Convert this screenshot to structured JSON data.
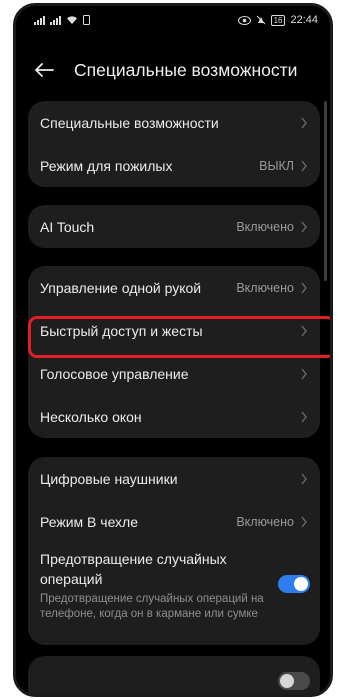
{
  "status": {
    "time": "22:44",
    "battery": "16"
  },
  "header": {
    "title": "Специальные возможности"
  },
  "group1": [
    {
      "label": "Специальные возможности",
      "value": ""
    },
    {
      "label": "Режим для пожилых",
      "value": "ВЫКЛ"
    }
  ],
  "group2": [
    {
      "label": "AI Touch",
      "value": "Включено"
    }
  ],
  "group3": [
    {
      "label": "Управление одной рукой",
      "value": "Включено"
    },
    {
      "label": "Быстрый доступ и жесты",
      "value": ""
    },
    {
      "label": "Голосовое управление",
      "value": ""
    },
    {
      "label": "Несколько окон",
      "value": ""
    }
  ],
  "group4": {
    "items": [
      {
        "label": "Цифровые наушники",
        "value": ""
      },
      {
        "label": "Режим В чехле",
        "value": "Включено"
      }
    ],
    "prevent": {
      "title": "Предотвращение случайных операций",
      "description": "Предотвращение случайных операций на телефоне, когда он в кармане или сумке",
      "enabled": true
    }
  },
  "colors": {
    "accent": "#2f7bf0",
    "highlight": "#e41e26",
    "card": "#1e1e1e"
  }
}
